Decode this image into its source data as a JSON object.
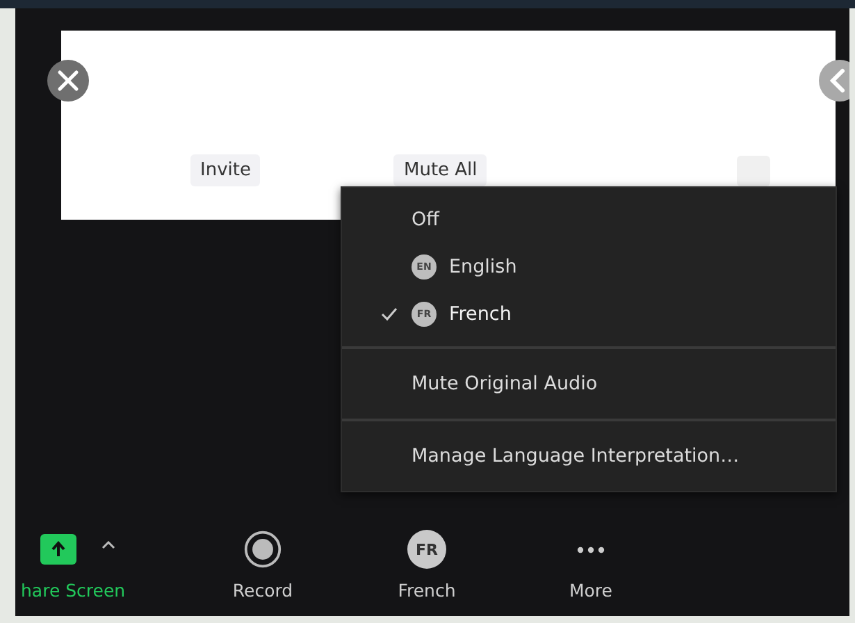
{
  "meeting_panel": {
    "buttons": [
      {
        "label": "Invite"
      },
      {
        "label": "Mute All"
      }
    ]
  },
  "interpretation_menu": {
    "sections": [
      {
        "items": [
          {
            "label": "Off",
            "checked": false
          },
          {
            "label": "English",
            "badge": "EN",
            "checked": false
          },
          {
            "label": "French",
            "badge": "FR",
            "checked": true
          }
        ]
      },
      {
        "items": [
          {
            "label": "Mute Original Audio"
          }
        ]
      },
      {
        "items": [
          {
            "label": "Manage Language Interpretation…"
          }
        ]
      }
    ]
  },
  "toolbar": [
    {
      "kind": "share",
      "label": "hare Screen"
    },
    {
      "kind": "record",
      "label": "Record"
    },
    {
      "kind": "language",
      "label": "French",
      "badge": "FR"
    },
    {
      "kind": "more",
      "label": "More"
    }
  ]
}
